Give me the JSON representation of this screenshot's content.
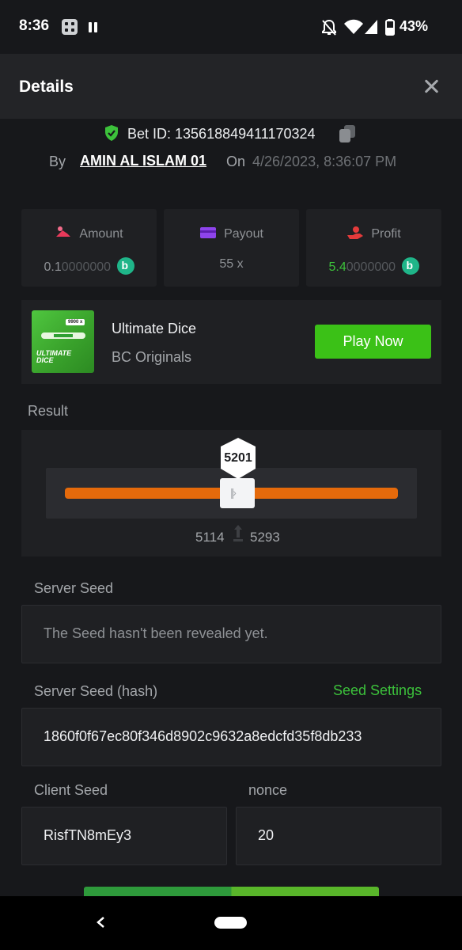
{
  "status_bar": {
    "time": "8:36",
    "battery": "43%"
  },
  "header": {
    "title": "Details"
  },
  "bet": {
    "id_text": "Bet ID: 135618849411170324",
    "by_label": "By",
    "user": "AMIN AL ISLAM 01",
    "on_label": "On",
    "datetime": "4/26/2023, 8:36:07 PM"
  },
  "stats": {
    "amount": {
      "label": "Amount",
      "value_main": "0.1",
      "value_dim": "0000000"
    },
    "payout": {
      "label": "Payout",
      "value": "55 x"
    },
    "profit": {
      "label": "Profit",
      "value_main": "5.4",
      "value_dim": "0000000"
    }
  },
  "game": {
    "name": "Ultimate Dice",
    "provider": "BC Originals",
    "play_label": "Play Now",
    "thumb_badge": "9900 x",
    "thumb_text_1": "ULTIMATE",
    "thumb_text_2": "DICE"
  },
  "result": {
    "label": "Result",
    "value": "5201",
    "range_low": "5114",
    "range_high": "5293"
  },
  "server_seed": {
    "label": "Server Seed",
    "value": "The Seed hasn't been revealed yet."
  },
  "server_seed_hash": {
    "label": "Server Seed (hash)",
    "settings_label": "Seed Settings",
    "value": "1860f0f67ec80f346d8902c9632a8edcfd35f8db233"
  },
  "client_seed": {
    "label": "Client Seed",
    "value": "RisfTN8mEy3"
  },
  "nonce": {
    "label": "nonce",
    "value": "20"
  },
  "colors": {
    "accent_green": "#3bc117",
    "slider_orange": "#e56a0b",
    "background": "#17181b"
  }
}
